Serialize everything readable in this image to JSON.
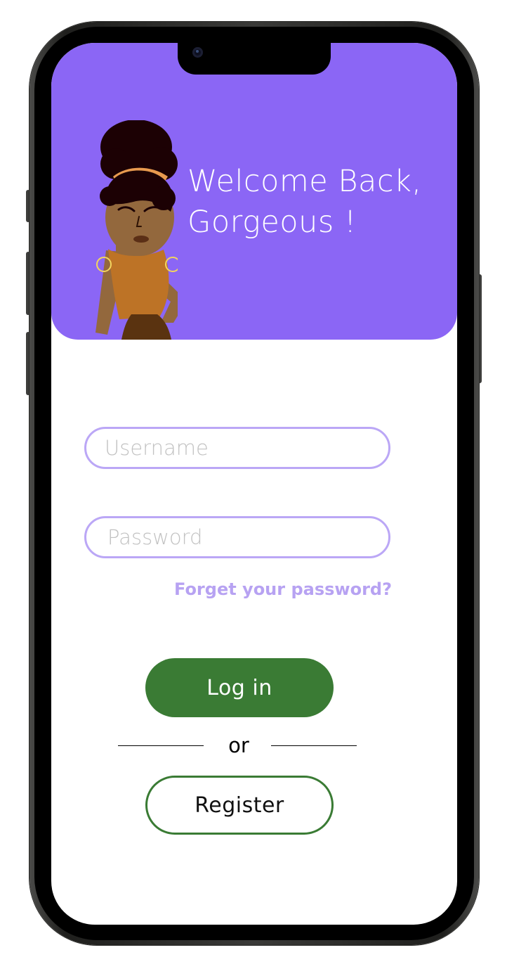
{
  "header": {
    "title_line_1": "Welcome Back,",
    "title_line_2": "Gorgeous !",
    "background_color": "#8b66f5",
    "illustration": "woman-avatar-illustration"
  },
  "login_form": {
    "username": {
      "value": "",
      "placeholder": "Username"
    },
    "password": {
      "value": "",
      "placeholder": "Password"
    },
    "forgot_password_label": "Forget your password?",
    "login_label": "Log in",
    "separator_label": "or",
    "register_label": "Register"
  },
  "colors": {
    "accent_purple": "#8b66f5",
    "field_border": "#bba7f6",
    "forgot_link": "#b7a2f2",
    "primary_green": "#3a7b34"
  },
  "icons": {
    "front_camera": "camera-icon"
  }
}
